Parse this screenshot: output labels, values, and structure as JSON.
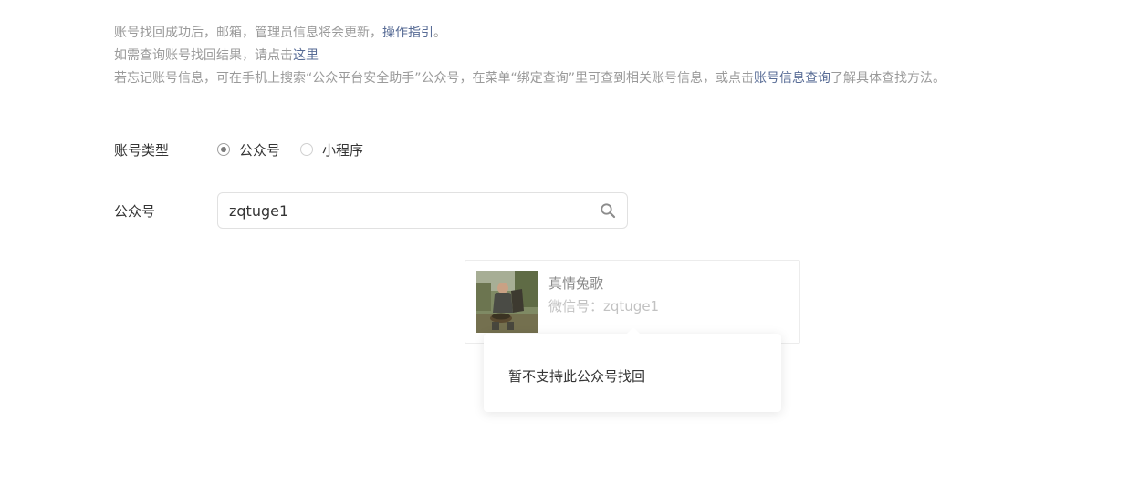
{
  "tips": {
    "line1_text": "账号找回成功后，邮箱，管理员信息将会更新，",
    "line1_link": "操作指引",
    "line1_end": "。",
    "line2_text": "如需查询账号找回结果，请点击",
    "line2_link": "这里",
    "line3_text": "若忘记账号信息，可在手机上搜索“公众平台安全助手”公众号，在菜单“绑定查询”里可查到相关账号信息，或点击",
    "line3_link": "账号信息查询",
    "line3_end": "了解具体查找方法。"
  },
  "account_type": {
    "label": "账号类型",
    "options": [
      {
        "label": "公众号",
        "checked": true
      },
      {
        "label": "小程序",
        "checked": false
      }
    ]
  },
  "search": {
    "label": "公众号",
    "value": "zqtuge1",
    "icon": "search-icon"
  },
  "result": {
    "name": "真情兔歌",
    "wechat_label": "微信号：",
    "wechat_id": "zqtuge1"
  },
  "popover": {
    "message": "暂不支持此公众号找回"
  },
  "colors": {
    "link": "#576b95",
    "tip_text": "#9a9a9a",
    "body_text": "#353535"
  }
}
